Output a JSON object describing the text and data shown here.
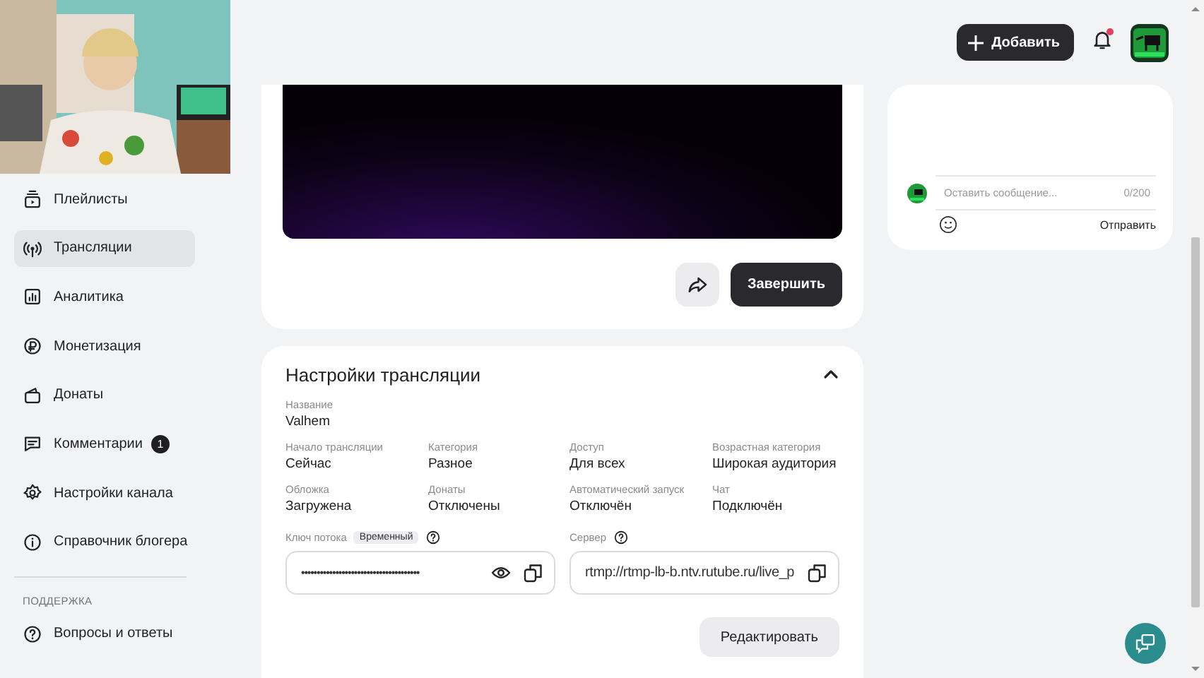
{
  "sidebar": {
    "items": [
      {
        "label": "Плейлисты",
        "selected": false
      },
      {
        "label": "Трансляции",
        "selected": true
      },
      {
        "label": "Аналитика",
        "selected": false
      },
      {
        "label": "Монетизация",
        "selected": false
      },
      {
        "label": "Донаты",
        "selected": false
      },
      {
        "label": "Комментарии",
        "selected": false,
        "badge": "1"
      },
      {
        "label": "Настройки канала",
        "selected": false
      },
      {
        "label": "Справочник блогера",
        "selected": false
      }
    ],
    "section_title": "ПОДДЕРЖКА",
    "support_items": [
      {
        "label": "Вопросы и ответы",
        "selected": false
      }
    ]
  },
  "header": {
    "add_button": "Добавить",
    "notifications": {
      "unread": true
    }
  },
  "stream": {
    "finish_button": "Завершить"
  },
  "settings": {
    "title": "Настройки трансляции",
    "expanded": true,
    "name": {
      "label": "Название",
      "value": "Valhem"
    },
    "fields": [
      {
        "label": "Начало трансляции",
        "value": "Сейчас"
      },
      {
        "label": "Категория",
        "value": "Разное"
      },
      {
        "label": "Доступ",
        "value": "Для всех"
      },
      {
        "label": "Возрастная категория",
        "value": "Широкая аудитория"
      },
      {
        "label": "Обложка",
        "value": "Загружена"
      },
      {
        "label": "Донаты",
        "value": "Отключены"
      },
      {
        "label": "Автоматический запуск",
        "value": "Отключён"
      },
      {
        "label": "Чат",
        "value": "Подключён"
      }
    ],
    "stream_key": {
      "label": "Ключ потока",
      "tag": "Временный",
      "value": "••••••••••••••••••••••••••••••••••••••"
    },
    "server": {
      "label": "Сервер",
      "value": "rtmp://rtmp-lb-b.ntv.rutube.ru/live_p"
    },
    "edit_button": "Редактировать"
  },
  "chat": {
    "placeholder": "Оставить сообщение...",
    "counter": "0/200",
    "send_button": "Отправить"
  }
}
